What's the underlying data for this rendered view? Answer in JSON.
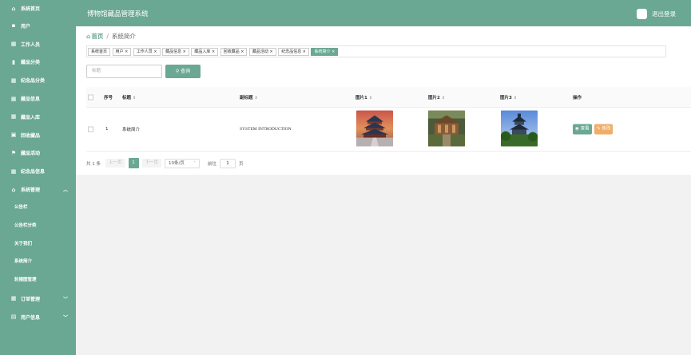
{
  "sidebar": {
    "items": [
      {
        "label": "系统首页",
        "icon": "home-icon"
      },
      {
        "label": "用户",
        "icon": "user-icon"
      },
      {
        "label": "工作人员",
        "icon": "grid-icon"
      },
      {
        "label": "藏品分类",
        "icon": "bookmark-icon"
      },
      {
        "label": "纪念品分类",
        "icon": "grid-icon"
      },
      {
        "label": "藏品信息",
        "icon": "grid-icon"
      },
      {
        "label": "藏品入库",
        "icon": "grid-icon"
      },
      {
        "label": "回收藏品",
        "icon": "calendar-icon"
      },
      {
        "label": "藏品活动",
        "icon": "flag-icon"
      },
      {
        "label": "纪念品信息",
        "icon": "grid-icon"
      },
      {
        "label": "系统管理",
        "icon": "bank-icon"
      }
    ],
    "sub_items": [
      "公告栏",
      "公告栏分类",
      "关于我们",
      "系统简介",
      "轮播图管理"
    ],
    "bottom_items": [
      {
        "label": "订单管理",
        "icon": "grid-icon"
      },
      {
        "label": "用户信息",
        "icon": "card-icon"
      }
    ]
  },
  "header": {
    "title": "博物馆藏品管理系统",
    "logout": "退出登录"
  },
  "breadcrumb": {
    "home": "首页",
    "current": "系统简介"
  },
  "tags": [
    "系统首页",
    "用户 ×",
    "工作人员 ×",
    "藏品信息 ×",
    "藏品入库 ×",
    "回收藏品 ×",
    "藏品活动 ×",
    "纪念品信息 ×",
    "系统简介 ×"
  ],
  "search": {
    "placeholder": "标题",
    "button": "查询"
  },
  "table": {
    "headers": {
      "index": "序号",
      "title": "标题",
      "subtitle": "副标题",
      "pic1": "图片1",
      "pic2": "图片2",
      "pic3": "图片3",
      "ops": "操作"
    },
    "rows": [
      {
        "index": "1",
        "title": "系统简介",
        "subtitle": "SYSTEM INTRODUCTION",
        "view": "查看",
        "edit": "修改"
      }
    ]
  },
  "pager": {
    "total": "共 1 条",
    "prev": "上一页",
    "page": "1",
    "next": "下一页",
    "size": "10条/页",
    "goto": "前往",
    "goto_value": "1",
    "unit": "页"
  },
  "colors": {
    "accent": "#6aa893",
    "edit": "#f0ad6a"
  }
}
